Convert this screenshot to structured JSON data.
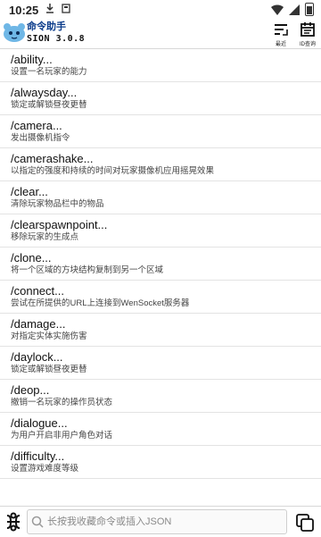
{
  "status_bar": {
    "time": "10:25"
  },
  "app": {
    "title": "命令助手",
    "version": "SION 3.0.8",
    "recent_label": "最近",
    "id_label": "ID查询"
  },
  "commands": [
    {
      "cmd": "/ability...",
      "desc": "设置一名玩家的能力"
    },
    {
      "cmd": "/alwaysday...",
      "desc": "锁定或解锁昼夜更替"
    },
    {
      "cmd": "/camera...",
      "desc": "发出摄像机指令"
    },
    {
      "cmd": "/camerashake...",
      "desc": "以指定的强度和持续的时间对玩家摄像机应用摇晃效果"
    },
    {
      "cmd": "/clear...",
      "desc": "清除玩家物品栏中的物品"
    },
    {
      "cmd": "/clearspawnpoint...",
      "desc": "移除玩家的生成点"
    },
    {
      "cmd": "/clone...",
      "desc": "将一个区域的方块结构复制到另一个区域"
    },
    {
      "cmd": "/connect...",
      "desc": "尝试在所提供的URL上连接到WenSocket服务器"
    },
    {
      "cmd": "/damage...",
      "desc": "对指定实体实施伤害"
    },
    {
      "cmd": "/daylock...",
      "desc": "锁定或解锁昼夜更替"
    },
    {
      "cmd": "/deop...",
      "desc": "撤销一名玩家的操作员状态"
    },
    {
      "cmd": "/dialogue...",
      "desc": "为用户开启非用户角色对话"
    },
    {
      "cmd": "/difficulty...",
      "desc": "设置游戏难度等级"
    }
  ],
  "search": {
    "placeholder": "长按我收藏命令或插入JSON"
  },
  "colors": {
    "title": "#0a3b8a",
    "logo": "#6fb7e6"
  }
}
